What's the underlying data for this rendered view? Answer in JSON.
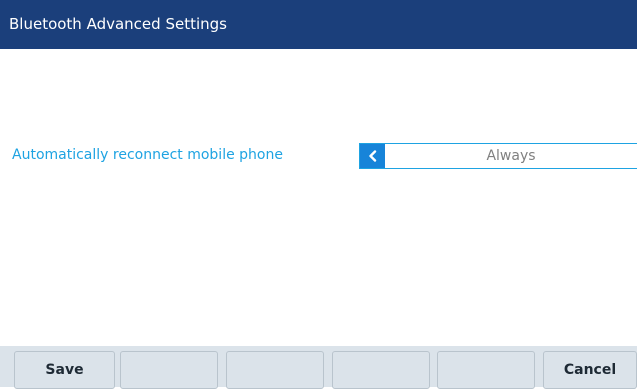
{
  "header": {
    "title": "Bluetooth Advanced Settings"
  },
  "setting": {
    "label": "Automatically reconnect mobile phone",
    "value": "Always",
    "prev_icon": "chevron-left-icon"
  },
  "softkeys": {
    "key1": "Save",
    "key2": "",
    "key3": "",
    "key4": "",
    "key5": "",
    "key6": "Cancel"
  },
  "colors": {
    "title_bar": "#1b3f7b",
    "accent": "#1ea3e2",
    "selector_arrow": "#1784d9",
    "softkey_bar": "#dbe3ea"
  }
}
